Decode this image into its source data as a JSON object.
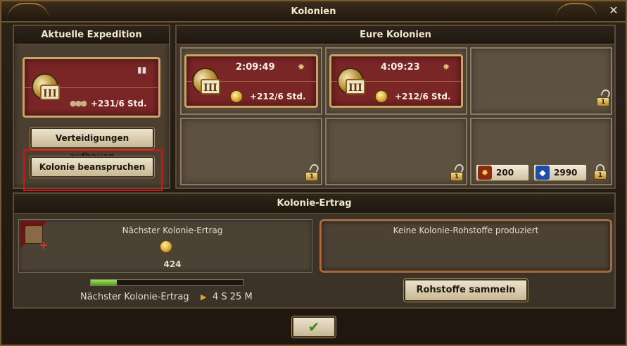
{
  "window": {
    "title": "Kolonien"
  },
  "left_panel": {
    "title": "Aktuelle Expedition",
    "expedition": {
      "tier": "III",
      "yield": "+231/6 Std."
    },
    "defend_button": "Verteidigungen aufbauen",
    "claim_button": "Kolonie beanspruchen"
  },
  "colonies_panel": {
    "title": "Eure Kolonien",
    "colonies": [
      {
        "tier": "III",
        "timer": "2:09:49",
        "yield": "+212/6 Std."
      },
      {
        "tier": "III",
        "timer": "4:09:23",
        "yield": "+212/6 Std."
      }
    ],
    "locked_slots": [
      "1",
      "1",
      "1",
      "1"
    ],
    "unlock_costs": {
      "gems": "200",
      "crystals": "2990"
    }
  },
  "ertrag": {
    "title": "Kolonie-Ertrag",
    "next_label": "Nächster Kolonie-Ertrag",
    "next_value": "424",
    "timer_label": "Nächster Kolonie-Ertrag",
    "timer_value": "4 S 25 M",
    "progress_fraction": 0.17,
    "resources_text": "Keine Kolonie-Rohstoffe produziert",
    "collect_button": "Rohstoffe sammeln"
  },
  "confirm_icon": "check-icon",
  "colors": {
    "banner_red": "#7a2526",
    "highlight": "#e01010",
    "progress": "#7fc23a"
  }
}
